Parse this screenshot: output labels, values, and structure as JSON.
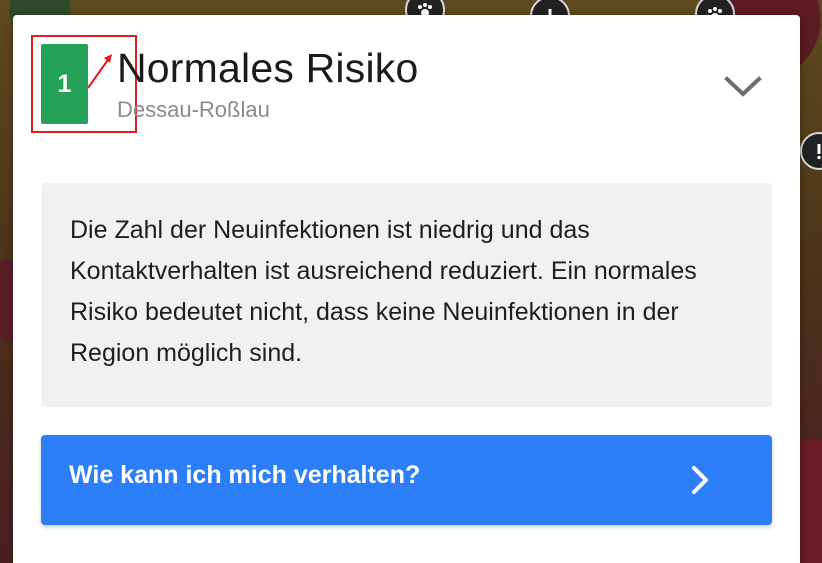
{
  "map": {
    "markers": [
      {
        "icon": "paw-icon"
      },
      {
        "icon": "exclamation-icon"
      },
      {
        "icon": "paw-icon"
      },
      {
        "icon": "exclamation-icon"
      }
    ]
  },
  "risk_card": {
    "level": "1",
    "level_color": "#24a25a",
    "title": "Normales Risiko",
    "region": "Dessau-Roßlau",
    "expand_icon": "chevron-down-icon",
    "description": "Die Zahl der Neuinfektionen ist niedrig und das Kontaktverhalten ist ausreichend reduziert. Ein normales Risiko bedeutet nicht, dass keine Neuinfektionen in der Region möglich sind.",
    "action_label": "Wie kann ich mich verhalten?",
    "action_icon": "chevron-right-icon",
    "action_color": "#2d7ff9",
    "annotation_color": "#e21c1c"
  }
}
